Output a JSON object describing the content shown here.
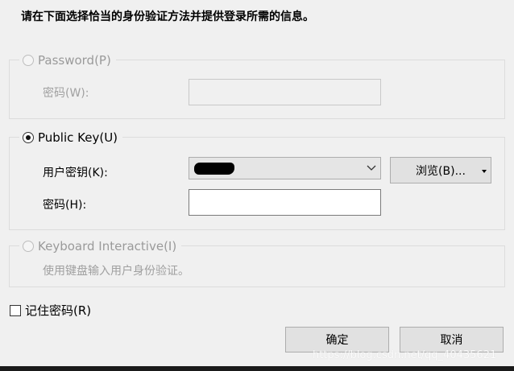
{
  "instruction": "请在下面选择恰当的身份验证方法并提供登录所需的信息。",
  "password_method": {
    "label": "Password(P)",
    "selected": false,
    "enabled": false,
    "field_label": "密码(W):",
    "field_value": ""
  },
  "publickey_method": {
    "label": "Public Key(U)",
    "selected": true,
    "enabled": true,
    "key_label": "用户密钥(K):",
    "key_value": "",
    "browse_label": "浏览(B)...",
    "password_label": "密码(H):",
    "password_value": ""
  },
  "keyboard_method": {
    "label": "Keyboard Interactive(I)",
    "selected": false,
    "enabled": false,
    "description": "使用键盘输入用户身份验证。"
  },
  "remember": {
    "label": "记住密码(R)",
    "checked": false
  },
  "buttons": {
    "ok": "确定",
    "cancel": "取消"
  },
  "watermark": "https://blog.csdn.net/qq_40435621",
  "icons": {
    "combo_arrow": "chevron-down-icon",
    "browse_arrow": "dropdown-arrow-icon"
  }
}
